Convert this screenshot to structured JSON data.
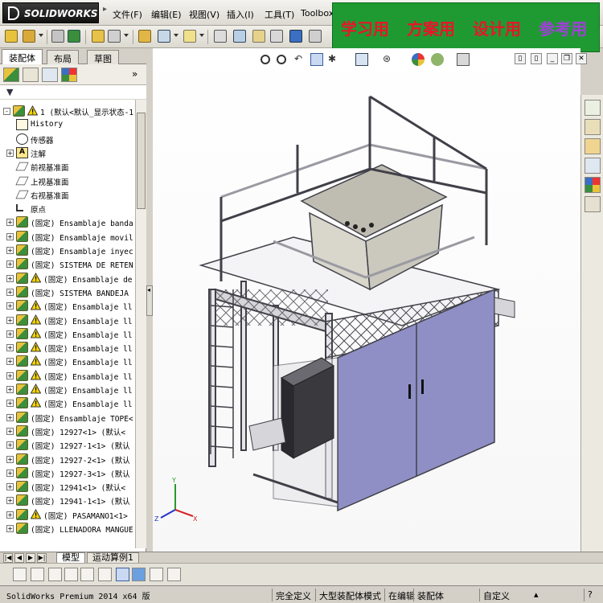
{
  "app": {
    "logo_text": "SOLIDWORKS",
    "menu": [
      "文件(F)",
      "编辑(E)",
      "视图(V)",
      "插入(I)",
      "工具(T)",
      "Toolbox"
    ]
  },
  "watermark": {
    "words": [
      "学习用",
      "方案用",
      "设计用",
      "参考用"
    ],
    "bg_color": "#1f9a32",
    "text_color": "#e8152a",
    "last_color": "#a040d8"
  },
  "left_panel": {
    "tabs": [
      "装配体",
      "布局",
      "草图"
    ],
    "active_tab": "装配体",
    "feature_manager_icons": [
      "feature-manager-icon",
      "property-manager-icon",
      "configuration-manager-icon",
      "display-manager-icon"
    ],
    "more_label": "»",
    "filter_icon": "filter-icon"
  },
  "tree": [
    {
      "kind": "asm",
      "warn": true,
      "expand": "-",
      "label": "1 (默认<默认_显示状态-1",
      "indent": 0
    },
    {
      "kind": "hist",
      "warn": false,
      "expand": "",
      "label": "History",
      "indent": 1
    },
    {
      "kind": "sens",
      "warn": false,
      "expand": "",
      "label": "传感器",
      "indent": 1
    },
    {
      "kind": "annot",
      "warn": false,
      "expand": "+",
      "label": "注解",
      "indent": 1
    },
    {
      "kind": "plane",
      "warn": false,
      "expand": "",
      "label": "前视基准面",
      "indent": 1
    },
    {
      "kind": "plane",
      "warn": false,
      "expand": "",
      "label": "上视基准面",
      "indent": 1
    },
    {
      "kind": "plane",
      "warn": false,
      "expand": "",
      "label": "右视基准面",
      "indent": 1
    },
    {
      "kind": "origin",
      "warn": false,
      "expand": "",
      "label": "原点",
      "indent": 1
    },
    {
      "kind": "asm",
      "warn": false,
      "expand": "+",
      "label": "(固定) Ensamblaje banda",
      "indent": 1
    },
    {
      "kind": "asm",
      "warn": false,
      "expand": "+",
      "label": "(固定) Ensamblaje movil",
      "indent": 1
    },
    {
      "kind": "asm",
      "warn": false,
      "expand": "+",
      "label": "(固定) Ensamblaje inyec",
      "indent": 1
    },
    {
      "kind": "asm",
      "warn": false,
      "expand": "+",
      "label": "(固定) SISTEMA DE RETEN",
      "indent": 1
    },
    {
      "kind": "asm",
      "warn": true,
      "expand": "+",
      "label": "(固定) Ensamblaje de",
      "indent": 1
    },
    {
      "kind": "asm",
      "warn": false,
      "expand": "+",
      "label": "(固定) SISTEMA BANDEJA",
      "indent": 1
    },
    {
      "kind": "asm",
      "warn": true,
      "expand": "+",
      "label": "(固定) Ensamblaje ll",
      "indent": 1
    },
    {
      "kind": "asm",
      "warn": true,
      "expand": "+",
      "label": "(固定) Ensamblaje ll",
      "indent": 1
    },
    {
      "kind": "asm",
      "warn": true,
      "expand": "+",
      "label": "(固定) Ensamblaje ll",
      "indent": 1
    },
    {
      "kind": "asm",
      "warn": true,
      "expand": "+",
      "label": "(固定) Ensamblaje ll",
      "indent": 1
    },
    {
      "kind": "asm",
      "warn": true,
      "expand": "+",
      "label": "(固定) Ensamblaje ll",
      "indent": 1
    },
    {
      "kind": "asm",
      "warn": true,
      "expand": "+",
      "label": "(固定) Ensamblaje ll",
      "indent": 1
    },
    {
      "kind": "asm",
      "warn": true,
      "expand": "+",
      "label": "(固定) Ensamblaje ll",
      "indent": 1
    },
    {
      "kind": "asm",
      "warn": true,
      "expand": "+",
      "label": "(固定) Ensamblaje ll",
      "indent": 1
    },
    {
      "kind": "asm",
      "warn": false,
      "expand": "+",
      "label": "(固定) Ensamblaje TOPE<",
      "indent": 1
    },
    {
      "kind": "asm",
      "warn": false,
      "expand": "+",
      "label": "(固定) 12927<1> (默认<",
      "indent": 1
    },
    {
      "kind": "asm",
      "warn": false,
      "expand": "+",
      "label": "(固定) 12927-1<1> (默认",
      "indent": 1
    },
    {
      "kind": "asm",
      "warn": false,
      "expand": "+",
      "label": "(固定) 12927-2<1> (默认",
      "indent": 1
    },
    {
      "kind": "asm",
      "warn": false,
      "expand": "+",
      "label": "(固定) 12927-3<1> (默认",
      "indent": 1
    },
    {
      "kind": "asm",
      "warn": false,
      "expand": "+",
      "label": "(固定) 12941<1> (默认<",
      "indent": 1
    },
    {
      "kind": "asm",
      "warn": false,
      "expand": "+",
      "label": "(固定) 12941-1<1> (默认",
      "indent": 1
    },
    {
      "kind": "asm",
      "warn": true,
      "expand": "+",
      "label": "(固定) PASAMANO1<1>",
      "indent": 1
    },
    {
      "kind": "asm",
      "warn": false,
      "expand": "+",
      "label": "(固定) LLENADORA MANGUE",
      "indent": 1
    }
  ],
  "bottom_tabs": {
    "nav": [
      "|◀",
      "◀",
      "▶",
      "▶|"
    ],
    "tabs": [
      "模型",
      "运动算例1"
    ],
    "active": "模型"
  },
  "status": {
    "product": "SolidWorks Premium 2014 x64 版",
    "items": [
      "完全定义",
      "大型装配体模式",
      "在编辑",
      "装配体",
      "自定义"
    ]
  },
  "colors": {
    "frame": "#e8e8ea",
    "frame_edge": "#404048",
    "cabinet_panel": "#8f8fc6",
    "cabinet_shadow": "#6e6ea6",
    "tank": "#d9d6cc",
    "electrical_box": "#3a3a3e"
  }
}
